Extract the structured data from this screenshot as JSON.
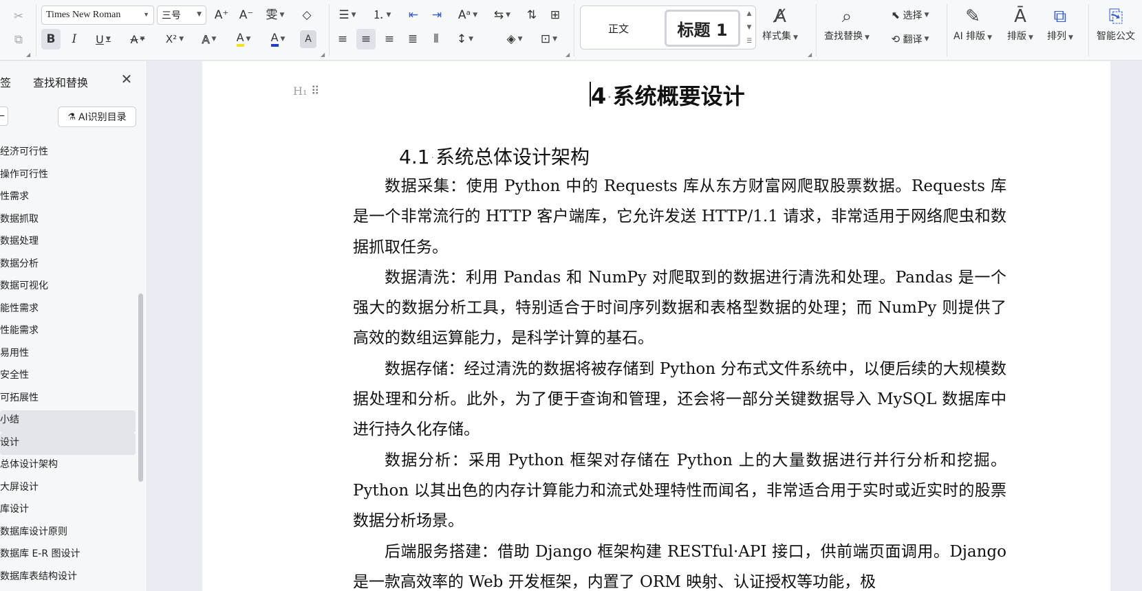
{
  "ribbon": {
    "clipboard": {
      "cut_icon": "scissors-icon",
      "copy_icon": "copy-icon"
    },
    "font": {
      "family": "Times New Roman",
      "size": "三号",
      "grow_label": "A⁺",
      "shrink_label": "A⁻",
      "phonetic_label": "雯",
      "clear_label": "◇",
      "bold_label": "B",
      "italic_label": "I",
      "underline_label": "U",
      "strike_label": "A",
      "superscript_label": "X²",
      "effects_label": "A",
      "highlight_label": "A",
      "font_color_label": "A",
      "char_shade_label": "A"
    },
    "styles": {
      "normal": "正文",
      "heading1": "标题 1",
      "styles_set": "样式集"
    },
    "find_replace": "查找替换",
    "select": "选择",
    "translate": "翻译",
    "ai_layout": "AI 排版",
    "layout": "排版",
    "arrange": "排列",
    "smart_doc": "智能公文",
    "colors": {
      "highlight": "#f5e21a",
      "font_color": "#1f3fd1"
    }
  },
  "sidebar": {
    "tabs": [
      "书签",
      "查找和替换"
    ],
    "ai_toc_label": "AI识别目录",
    "toc": [
      "经济可行性",
      "操作可行性",
      "性需求",
      "数据抓取",
      "数据处理",
      "数据分析",
      "数据可视化",
      "能性需求",
      "性能需求",
      "易用性",
      "安全性",
      "可拓展性",
      "小结",
      "设计",
      "总体设计架构",
      "大屏设计",
      "库设计",
      "数据库设计原则",
      "数据库 E-R 图设计",
      "数据库表结构设计"
    ],
    "highlighted": [
      12,
      13
    ]
  },
  "document": {
    "heading1_number": "4",
    "heading1_text": "系统概要设计",
    "heading2_number": "4.1",
    "heading2_text": "系统总体设计架构",
    "paragraphs": [
      "数据采集：使用 Python 中的 Requests 库从东方财富网爬取股票数据。Requests 库是一个非常流行的 HTTP 客户端库，它允许发送 HTTP/1.1 请求，非常适用于网络爬虫和数据抓取任务。",
      "数据清洗：利用 Pandas 和 NumPy 对爬取到的数据进行清洗和处理。Pandas 是一个强大的数据分析工具，特别适合于时间序列数据和表格型数据的处理；而 NumPy 则提供了高效的数组运算能力，是科学计算的基石。",
      "数据存储：经过清洗的数据将被存储到 Python 分布式文件系统中，以便后续的大规模数据处理和分析。此外，为了便于查询和管理，还会将一部分关键数据导入 MySQL 数据库中进行持久化存储。",
      "数据分析：采用 Python 框架对存储在 Python 上的大量数据进行并行分析和挖掘。Python 以其出色的内存计算能力和流式处理特性而闻名，非常适合用于实时或近实时的股票数据分析场景。",
      "后端服务搭建：借助 Django 框架构建 RESTful·API 接口，供前端页面调用。Django 是一款高效率的 Web 开发框架，内置了 ORM 映射、认证授权等功能，极"
    ]
  }
}
